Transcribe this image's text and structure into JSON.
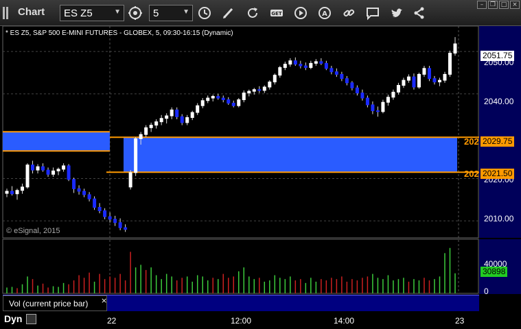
{
  "window": {
    "title": "Chart"
  },
  "toolbar": {
    "symbol": "ES Z5",
    "interval": "5",
    "icons": [
      "settings-icon",
      "clock-icon",
      "pencil-icon",
      "refresh-icon",
      "get-icon",
      "play-icon",
      "alert-icon",
      "link-icon",
      "comment-icon",
      "twitter-icon",
      "share-icon"
    ],
    "get_label": "GET"
  },
  "chart": {
    "header": "* ES Z5, S&P 500 E-MINI FUTURES - GLOBEX, 5, 09:30-16:15 (Dynamic)",
    "copyright": "© eSignal, 2015",
    "current_price": "2051.75",
    "level_high": {
      "value": 2029.75,
      "label": "2029.75",
      "cut_label": "202"
    },
    "level_low": {
      "value": 2021.5,
      "label": "2021.50",
      "cut_label": "202"
    },
    "price_ticks": [
      {
        "value": 2050,
        "label": "2050.00"
      },
      {
        "value": 2040,
        "label": "2040.00"
      },
      {
        "value": 2020,
        "label": "2020.00"
      },
      {
        "value": 2010,
        "label": "2010.00"
      }
    ],
    "colors": {
      "zone": "#2a5cff",
      "level": "#ff9a00",
      "axis_bg": "#00005a",
      "up_vol": "#3ccc3c",
      "down_vol": "#cc2020"
    }
  },
  "volume": {
    "study_label": "Vol (current price bar)",
    "close_label": "×",
    "current": "30898",
    "ticks": [
      {
        "value": 40000,
        "label": "40000"
      },
      {
        "value": 0,
        "label": "0"
      }
    ]
  },
  "time_axis": {
    "dyn_label": "Dyn",
    "labels": [
      "22",
      "12:00",
      "14:00",
      "23"
    ]
  },
  "chart_data": {
    "type": "candlestick",
    "ylim": [
      2006,
      2056
    ],
    "vol_ylim": [
      0,
      75000
    ],
    "candles": [
      [
        2016.5,
        2017.6,
        2015.6,
        2017.0
      ],
      [
        2017.0,
        2018.2,
        2016.0,
        2016.4
      ],
      [
        2016.4,
        2017.6,
        2015.0,
        2017.2
      ],
      [
        2017.2,
        2018.8,
        2016.4,
        2018.0
      ],
      [
        2018.0,
        2023.6,
        2017.6,
        2023.2
      ],
      [
        2023.2,
        2024.2,
        2021.2,
        2022.0
      ],
      [
        2022.0,
        2023.4,
        2021.2,
        2022.8
      ],
      [
        2022.8,
        2023.6,
        2021.6,
        2022.0
      ],
      [
        2022.0,
        2022.6,
        2020.4,
        2021.0
      ],
      [
        2021.0,
        2022.6,
        2020.4,
        2021.8
      ],
      [
        2021.8,
        2022.6,
        2020.8,
        2022.2
      ],
      [
        2022.2,
        2023.6,
        2021.6,
        2023.0
      ],
      [
        2023.0,
        2023.4,
        2019.4,
        2019.8
      ],
      [
        2019.8,
        2020.2,
        2016.6,
        2017.6
      ],
      [
        2017.6,
        2018.4,
        2016.2,
        2017.0
      ],
      [
        2017.0,
        2017.6,
        2015.6,
        2016.2
      ],
      [
        2016.2,
        2016.8,
        2014.6,
        2015.2
      ],
      [
        2015.2,
        2015.8,
        2012.6,
        2013.2
      ],
      [
        2013.2,
        2014.2,
        2011.8,
        2012.4
      ],
      [
        2012.4,
        2013.0,
        2010.4,
        2011.0
      ],
      [
        2011.0,
        2012.0,
        2009.6,
        2010.4
      ],
      [
        2010.4,
        2011.2,
        2008.8,
        2009.6
      ],
      [
        2009.6,
        2010.6,
        2007.8,
        2008.4
      ],
      [
        2008.4,
        2009.2,
        2007.4,
        2008.0
      ],
      [
        2018.0,
        2022.0,
        2017.4,
        2021.4
      ],
      [
        2021.4,
        2029.8,
        2020.6,
        2029.4
      ],
      [
        2029.4,
        2031.0,
        2028.0,
        2030.4
      ],
      [
        2030.4,
        2032.6,
        2029.8,
        2032.0
      ],
      [
        2032.0,
        2033.2,
        2031.0,
        2032.6
      ],
      [
        2032.6,
        2034.0,
        2031.8,
        2033.4
      ],
      [
        2033.4,
        2035.0,
        2032.6,
        2034.2
      ],
      [
        2034.2,
        2035.4,
        2033.0,
        2034.8
      ],
      [
        2034.8,
        2036.8,
        2034.0,
        2036.2
      ],
      [
        2036.2,
        2036.8,
        2034.0,
        2034.6
      ],
      [
        2034.6,
        2035.2,
        2032.6,
        2033.2
      ],
      [
        2033.2,
        2035.0,
        2032.6,
        2034.4
      ],
      [
        2034.4,
        2036.0,
        2033.8,
        2035.6
      ],
      [
        2035.6,
        2037.8,
        2035.0,
        2037.2
      ],
      [
        2037.2,
        2039.0,
        2036.6,
        2038.4
      ],
      [
        2038.4,
        2039.6,
        2037.8,
        2039.0
      ],
      [
        2039.0,
        2039.8,
        2038.2,
        2039.4
      ],
      [
        2039.4,
        2040.0,
        2038.6,
        2039.0
      ],
      [
        2039.0,
        2039.6,
        2038.0,
        2038.6
      ],
      [
        2038.6,
        2039.2,
        2037.4,
        2037.8
      ],
      [
        2037.8,
        2038.4,
        2036.8,
        2037.2
      ],
      [
        2037.2,
        2039.0,
        2036.8,
        2038.6
      ],
      [
        2038.6,
        2040.8,
        2038.0,
        2040.2
      ],
      [
        2040.2,
        2041.0,
        2039.4,
        2040.6
      ],
      [
        2040.6,
        2041.4,
        2039.8,
        2041.0
      ],
      [
        2041.0,
        2041.8,
        2040.2,
        2040.8
      ],
      [
        2040.8,
        2042.0,
        2040.2,
        2041.6
      ],
      [
        2041.6,
        2043.2,
        2041.0,
        2042.8
      ],
      [
        2042.8,
        2044.8,
        2042.2,
        2044.4
      ],
      [
        2044.4,
        2046.6,
        2043.8,
        2046.2
      ],
      [
        2046.2,
        2047.6,
        2045.6,
        2047.0
      ],
      [
        2047.0,
        2048.4,
        2046.4,
        2047.8
      ],
      [
        2047.8,
        2048.6,
        2046.6,
        2047.0
      ],
      [
        2047.0,
        2047.8,
        2046.0,
        2046.6
      ],
      [
        2046.6,
        2047.4,
        2045.6,
        2046.2
      ],
      [
        2046.2,
        2047.8,
        2045.8,
        2047.2
      ],
      [
        2047.2,
        2048.2,
        2046.6,
        2047.6
      ],
      [
        2047.6,
        2048.4,
        2046.8,
        2047.2
      ],
      [
        2047.2,
        2047.8,
        2045.6,
        2046.0
      ],
      [
        2046.0,
        2046.6,
        2044.6,
        2045.2
      ],
      [
        2045.2,
        2046.0,
        2044.0,
        2044.6
      ],
      [
        2044.6,
        2045.2,
        2043.0,
        2043.6
      ],
      [
        2043.6,
        2044.2,
        2042.0,
        2042.6
      ],
      [
        2042.6,
        2043.0,
        2040.8,
        2041.4
      ],
      [
        2041.4,
        2042.0,
        2039.6,
        2040.2
      ],
      [
        2040.2,
        2041.0,
        2038.4,
        2039.0
      ],
      [
        2039.0,
        2039.6,
        2036.8,
        2037.4
      ],
      [
        2037.4,
        2038.2,
        2035.2,
        2036.0
      ],
      [
        2036.0,
        2037.0,
        2034.6,
        2035.8
      ],
      [
        2035.8,
        2038.6,
        2035.4,
        2038.0
      ],
      [
        2038.0,
        2039.8,
        2037.2,
        2039.2
      ],
      [
        2039.2,
        2041.0,
        2038.6,
        2040.4
      ],
      [
        2040.4,
        2042.6,
        2039.8,
        2042.0
      ],
      [
        2042.0,
        2043.8,
        2041.4,
        2043.2
      ],
      [
        2043.2,
        2044.6,
        2042.6,
        2044.0
      ],
      [
        2044.0,
        2044.8,
        2041.0,
        2041.6
      ],
      [
        2041.6,
        2045.0,
        2041.2,
        2044.6
      ],
      [
        2044.6,
        2046.6,
        2044.0,
        2046.0
      ],
      [
        2046.0,
        2046.6,
        2043.0,
        2043.6
      ],
      [
        2043.6,
        2044.2,
        2042.2,
        2042.8
      ],
      [
        2042.8,
        2043.8,
        2041.8,
        2043.2
      ],
      [
        2043.2,
        2045.2,
        2042.6,
        2044.6
      ],
      [
        2044.6,
        2050.2,
        2044.0,
        2049.6
      ],
      [
        2049.6,
        2053.4,
        2049.0,
        2051.8
      ]
    ],
    "volumes": [
      [
        9000,
        1
      ],
      [
        10000,
        1
      ],
      [
        8000,
        0
      ],
      [
        14000,
        1
      ],
      [
        26000,
        1
      ],
      [
        22000,
        0
      ],
      [
        12000,
        1
      ],
      [
        15000,
        0
      ],
      [
        9000,
        0
      ],
      [
        11000,
        1
      ],
      [
        10000,
        1
      ],
      [
        16000,
        1
      ],
      [
        14000,
        0
      ],
      [
        20000,
        0
      ],
      [
        28000,
        0
      ],
      [
        24000,
        0
      ],
      [
        32000,
        0
      ],
      [
        18000,
        1
      ],
      [
        30000,
        0
      ],
      [
        22000,
        0
      ],
      [
        26000,
        0
      ],
      [
        24000,
        0
      ],
      [
        30000,
        0
      ],
      [
        20000,
        0
      ],
      [
        64000,
        0
      ],
      [
        40000,
        1
      ],
      [
        44000,
        1
      ],
      [
        36000,
        0
      ],
      [
        40000,
        1
      ],
      [
        28000,
        1
      ],
      [
        22000,
        1
      ],
      [
        30000,
        1
      ],
      [
        26000,
        1
      ],
      [
        20000,
        0
      ],
      [
        24000,
        0
      ],
      [
        26000,
        1
      ],
      [
        18000,
        1
      ],
      [
        28000,
        1
      ],
      [
        26000,
        1
      ],
      [
        20000,
        1
      ],
      [
        24000,
        0
      ],
      [
        22000,
        1
      ],
      [
        30000,
        0
      ],
      [
        24000,
        0
      ],
      [
        26000,
        0
      ],
      [
        34000,
        1
      ],
      [
        40000,
        1
      ],
      [
        26000,
        1
      ],
      [
        22000,
        1
      ],
      [
        24000,
        0
      ],
      [
        18000,
        1
      ],
      [
        20000,
        1
      ],
      [
        28000,
        1
      ],
      [
        24000,
        1
      ],
      [
        22000,
        1
      ],
      [
        26000,
        1
      ],
      [
        20000,
        0
      ],
      [
        22000,
        0
      ],
      [
        16000,
        1
      ],
      [
        24000,
        1
      ],
      [
        18000,
        1
      ],
      [
        22000,
        0
      ],
      [
        20000,
        0
      ],
      [
        24000,
        0
      ],
      [
        22000,
        0
      ],
      [
        26000,
        0
      ],
      [
        18000,
        0
      ],
      [
        22000,
        0
      ],
      [
        20000,
        0
      ],
      [
        24000,
        0
      ],
      [
        26000,
        0
      ],
      [
        30000,
        1
      ],
      [
        24000,
        1
      ],
      [
        22000,
        1
      ],
      [
        28000,
        1
      ],
      [
        20000,
        1
      ],
      [
        22000,
        1
      ],
      [
        24000,
        1
      ],
      [
        18000,
        0
      ],
      [
        22000,
        1
      ],
      [
        20000,
        1
      ],
      [
        24000,
        0
      ],
      [
        20000,
        0
      ],
      [
        22000,
        1
      ],
      [
        26000,
        1
      ],
      [
        62000,
        1
      ],
      [
        70000,
        1
      ],
      [
        30898,
        1
      ]
    ]
  }
}
